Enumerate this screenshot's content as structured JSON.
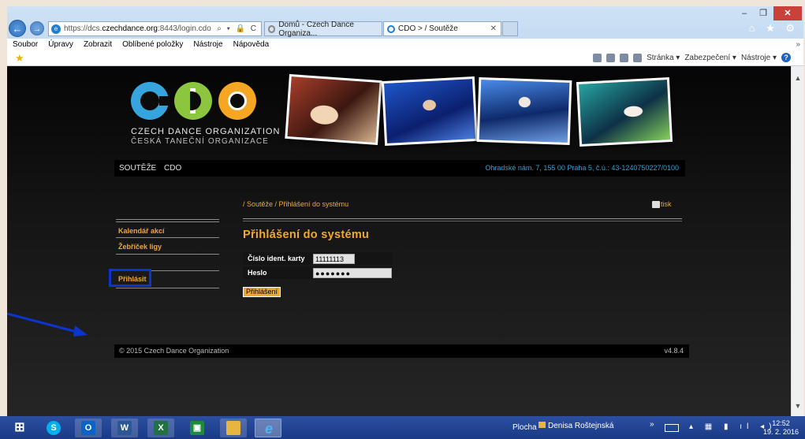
{
  "browser": {
    "window_controls": {
      "minimize": "‒",
      "maximize": "❐",
      "close": "✕"
    },
    "url_prefix": "https://dcs.",
    "url_domain": "czechdance.org",
    "url_suffix": ":8443/login.cdo",
    "address_icons": "⌕ ▾ 🔒 C",
    "tabs": [
      {
        "title": "Domů - Czech Dance Organiza..."
      },
      {
        "title": "CDO > / Soutěže",
        "close": "✕"
      }
    ],
    "toolbar_right_icons": "⌂ ★ ⚙",
    "menu": [
      "Soubor",
      "Úpravy",
      "Zobrazit",
      "Oblíbené položky",
      "Nástroje",
      "Nápověda"
    ],
    "menu_overflow": "»",
    "command_bar": [
      "Stránka ▾",
      "Zabezpečení ▾",
      "Nástroje ▾"
    ]
  },
  "site": {
    "logo_title": "CZECH DANCE ORGANIZATION",
    "logo_subtitle": "ČESKÁ TANEČNÍ ORGANIZACE",
    "nav": [
      "SOUTĚŽE",
      "CDO"
    ],
    "address": "Ohradské nám. 7, 155 00 Praha 5, č.ú.: 43-1240750227/0100",
    "sidebar": [
      "Kalendář akcí",
      "Žebříček ligy"
    ],
    "sidebar_login": "Přihlásit",
    "breadcrumb": "/ Soutěže / Přihlášení do systému",
    "print": "tisk",
    "page_title": "Přihlášení do systému",
    "form": {
      "card_label": "Číslo ident. karty",
      "card_value": "11111113",
      "password_label": "Heslo",
      "password_value": "●●●●●●●",
      "submit": "Přihlášení"
    },
    "footer_copyright": "© 2015 Czech Dance Organization",
    "footer_version": "v4.8.4"
  },
  "taskbar": {
    "apps": [
      "start",
      "skype",
      "outlook",
      "word",
      "excel",
      "store",
      "file-explorer",
      "internet-explorer"
    ],
    "desktop_label": "Plocha",
    "user_folder": "Denisa Roštejnská",
    "tray_chevron": "»",
    "time": "12:52",
    "date": "19. 2. 2016"
  },
  "colors": {
    "accent": "#f0a830",
    "address_blue": "#2aa3dc",
    "annotation": "#0c34cf"
  }
}
